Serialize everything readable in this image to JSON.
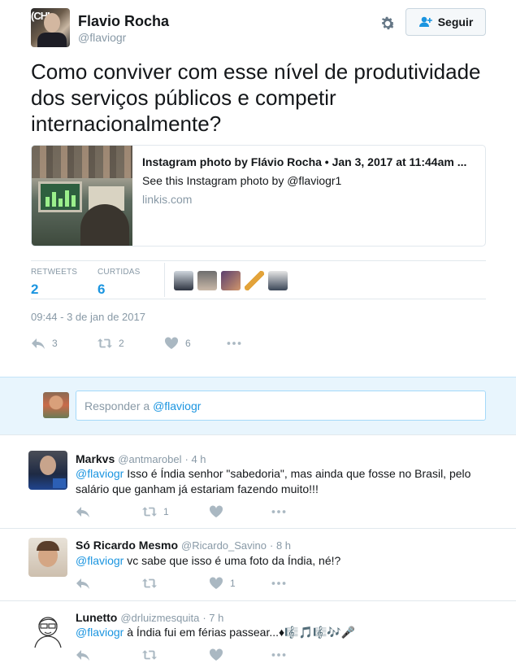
{
  "header": {
    "name": "Flavio Rocha",
    "handle": "@flaviogr",
    "avatar_logo_text": "(CHI",
    "follow_label": "Seguir"
  },
  "tweet": {
    "text": "Como conviver com esse nível de produtividade dos serviços públicos e competir internacionalmente?",
    "card": {
      "title": "Instagram photo by Flávio Rocha • Jan 3, 2017 at 11:44am ...",
      "description": "See this Instagram photo by @flaviogr1",
      "domain": "linkis.com"
    },
    "stats": {
      "retweets_label": "RETWEETS",
      "retweets_value": "2",
      "likes_label": "CURTIDAS",
      "likes_value": "6"
    },
    "timestamp": "09:44 - 3 de jan de 2017",
    "actions": {
      "retweet_count": "2",
      "like_count": "6",
      "reply_count": "3"
    }
  },
  "reply_box": {
    "placeholder_prefix": "Responder a ",
    "placeholder_mention": "@flaviogr"
  },
  "replies": [
    {
      "name": "Markvs",
      "handle": "@antmarobel",
      "time": "· 4 h",
      "mention": "@flaviogr",
      "text": " Isso é Índia senhor \"sabedoria\", mas ainda que fosse no Brasil, pelo salário que ganham já estariam fazendo muito!!!",
      "retweet_count": "1",
      "like_count": ""
    },
    {
      "name": "Só Ricardo Mesmo",
      "handle": "@Ricardo_Savino",
      "time": "· 8 h",
      "mention": "@flaviogr",
      "text": " vc sabe que isso é uma foto da Índia, né!?",
      "retweet_count": "",
      "like_count": "1"
    },
    {
      "name": "Lunetto",
      "handle": "@drluizmesquita",
      "time": "· 7 h",
      "mention": "@flaviogr",
      "text": " à Índia fui em férias passear...♦🎼🎵🎼🎶🎤",
      "retweet_count": "",
      "like_count": ""
    }
  ],
  "colors": {
    "link": "#1b95e0",
    "muted": "#8899a6",
    "reply_bg": "#e8f5fd"
  }
}
